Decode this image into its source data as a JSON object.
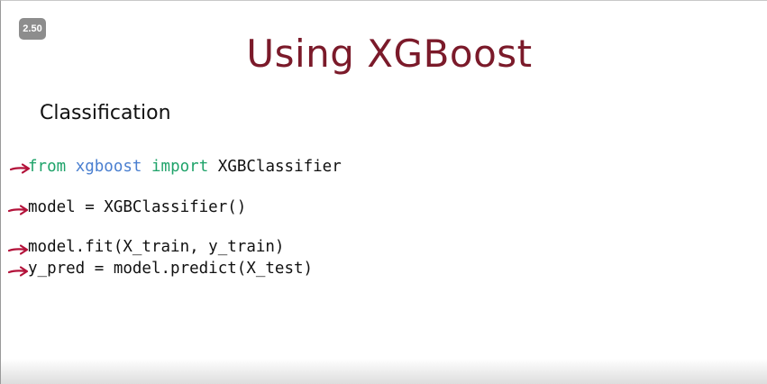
{
  "player": {
    "speed_badge": "2.50"
  },
  "slide": {
    "title": "Using XGBoost",
    "subtitle": "Classification",
    "code": {
      "line1": {
        "from_kw": "from",
        "module": "xgboost",
        "import_kw": "import",
        "name": "XGBClassifier"
      },
      "line2": "model = XGBClassifier()",
      "line3": "model.fit(X_train, y_train)",
      "line4": "y_pred = model.predict(X_test)"
    }
  },
  "colors": {
    "title": "#7b1a2a",
    "keyword": "#1fa36a",
    "module": "#4a7fd0",
    "annotation_arrow": "#b3123a"
  },
  "icons": [
    "annotation-arrow-icon"
  ]
}
